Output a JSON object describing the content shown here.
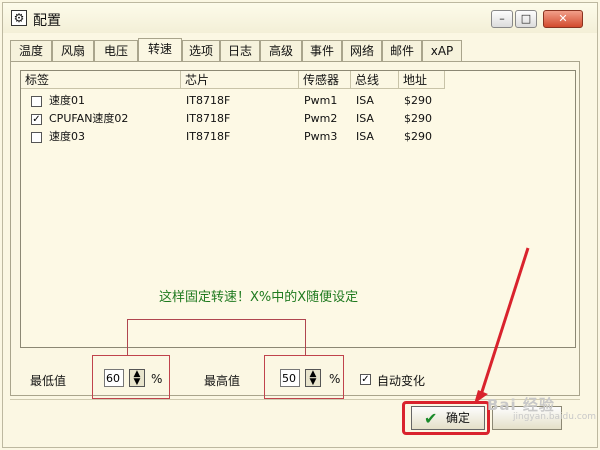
{
  "window": {
    "title": "配置"
  },
  "tabs": [
    {
      "label": "温度"
    },
    {
      "label": "风扇"
    },
    {
      "label": "电压"
    },
    {
      "label": "转速"
    },
    {
      "label": "选项"
    },
    {
      "label": "日志"
    },
    {
      "label": "高级"
    },
    {
      "label": "事件"
    },
    {
      "label": "网络"
    },
    {
      "label": "邮件"
    },
    {
      "label": "xAP"
    }
  ],
  "active_tab": "转速",
  "table": {
    "headers": [
      "标签",
      "芯片",
      "传感器",
      "总线",
      "地址"
    ],
    "rows": [
      {
        "checked": "",
        "label": "速度01",
        "chip": "IT8718F",
        "sensor": "Pwm1",
        "bus": "ISA",
        "addr": "$290"
      },
      {
        "checked": "✓",
        "label": "CPUFAN速度02",
        "chip": "IT8718F",
        "sensor": "Pwm2",
        "bus": "ISA",
        "addr": "$290"
      },
      {
        "checked": "",
        "label": "速度03",
        "chip": "IT8718F",
        "sensor": "Pwm3",
        "bus": "ISA",
        "addr": "$290"
      }
    ]
  },
  "annotation": "这样固定转速！X%中的X随便设定",
  "controls": {
    "min_label": "最低值",
    "min_value": "60",
    "max_label": "最高值",
    "max_value": "50",
    "percent": "%",
    "auto_label": "自动变化",
    "auto_checked": "✓"
  },
  "buttons": {
    "ok": "确定"
  },
  "watermark": {
    "main": "Bai 经验",
    "sub": "jingyan.baidu.com"
  },
  "colors": {
    "accent_red": "#d9232d",
    "note_green": "#1f7a1f",
    "ok_check": "#1a8a2a"
  }
}
